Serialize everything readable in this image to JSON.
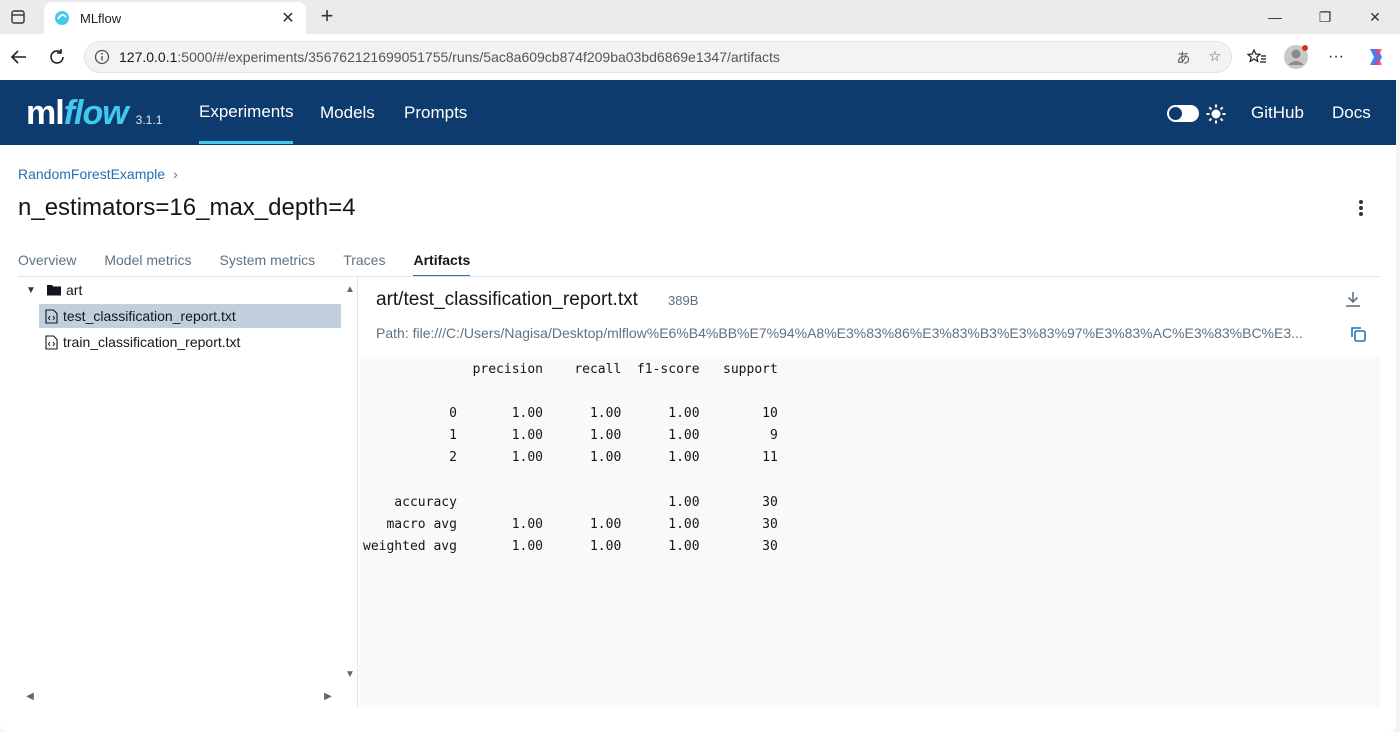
{
  "browser": {
    "tab_title": "MLflow",
    "url_host": "127.0.0.1",
    "url_rest": ":5000/#/experiments/356762121699051755/runs/5ac8a609cb874f209ba03bd6869e1347/artifacts"
  },
  "header": {
    "logo_ml": "ml",
    "logo_flow": "flow",
    "version": "3.1.1",
    "nav": [
      "Experiments",
      "Models",
      "Prompts"
    ],
    "right_links": [
      "GitHub",
      "Docs"
    ]
  },
  "page": {
    "breadcrumb": "RandomForestExample",
    "title": "n_estimators=16_max_depth=4",
    "tabs": [
      "Overview",
      "Model metrics",
      "System metrics",
      "Traces",
      "Artifacts"
    ],
    "active_tab": "Artifacts"
  },
  "tree": {
    "folder": "art",
    "files": [
      "test_classification_report.txt",
      "train_classification_report.txt"
    ],
    "selected": "test_classification_report.txt"
  },
  "viewer": {
    "file_name": "art/test_classification_report.txt",
    "file_size": "389B",
    "path": "Path: file:///C:/Users/Nagisa/Desktop/mlflow%E6%B4%BB%E7%94%A8%E3%83%86%E3%83%B3%E3%83%97%E3%83%AC%E3%83%BC%E3..."
  },
  "report": {
    "header": "              precision    recall  f1-score   support",
    "rows": [
      "",
      "           0       1.00      1.00      1.00        10",
      "           1       1.00      1.00      1.00         9",
      "           2       1.00      1.00      1.00        11",
      "",
      "    accuracy                           1.00        30",
      "   macro avg       1.00      1.00      1.00        30",
      "weighted avg       1.00      1.00      1.00        30"
    ]
  },
  "colors": {
    "header_bg": "#0e3b6e",
    "accent": "#43c9ed",
    "link": "#2272b4",
    "selected_row": "#c2cfdc"
  }
}
